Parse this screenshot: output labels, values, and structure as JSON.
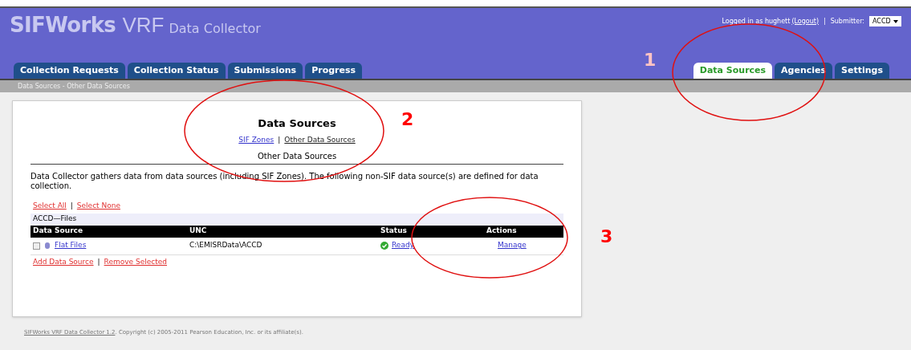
{
  "header": {
    "logo_bold": "SIFWorks",
    "logo_light": "VRF",
    "subtitle": "Data Collector",
    "login_text": "Logged in as hughett",
    "logout": "(Logout)",
    "separator": "|",
    "submitter_label": "Submitter:",
    "submitter_value": "ACCD"
  },
  "tabs_left": [
    {
      "label": "Collection Requests",
      "selected": false
    },
    {
      "label": "Collection Status",
      "selected": false
    },
    {
      "label": "Submissions",
      "selected": false
    },
    {
      "label": "Progress",
      "selected": false
    }
  ],
  "tabs_right": [
    {
      "label": "Data Sources",
      "selected": true
    },
    {
      "label": "Agencies",
      "selected": false
    },
    {
      "label": "Settings",
      "selected": false
    }
  ],
  "breadcrumb": "Data Sources - Other Data Sources",
  "panel": {
    "title": "Data Sources",
    "links": [
      {
        "label": "SIF Zones",
        "selected": false
      },
      {
        "label": "Other Data Sources",
        "selected": true
      }
    ],
    "link_separator": "|",
    "subtitle": "Other Data Sources",
    "description": "Data Collector gathers data from data sources (including SIF Zones). The following non-SIF data source(s) are defined for data collection.",
    "select_links": [
      "Select All",
      "Select None"
    ],
    "select_separator": "|",
    "bottom_separator": "|",
    "group": "ACCD—Files",
    "columns": [
      "Data Source",
      "UNC",
      "Status",
      "Actions"
    ],
    "rows": [
      {
        "checked": false,
        "name": "Flat Files",
        "unc": "C:\\EMISRData\\ACCD",
        "status": "Ready",
        "action": "Manage"
      }
    ],
    "bottom_links": [
      "Add Data Source",
      "Remove Selected"
    ]
  },
  "footer": {
    "link": "SIFWorks VRF Data Collector 1.2",
    "text": ". Copyright (c) 2005-2011 Pearson Education, Inc. or its affiliate(s)."
  },
  "annotations": [
    "1",
    "2",
    "3"
  ]
}
